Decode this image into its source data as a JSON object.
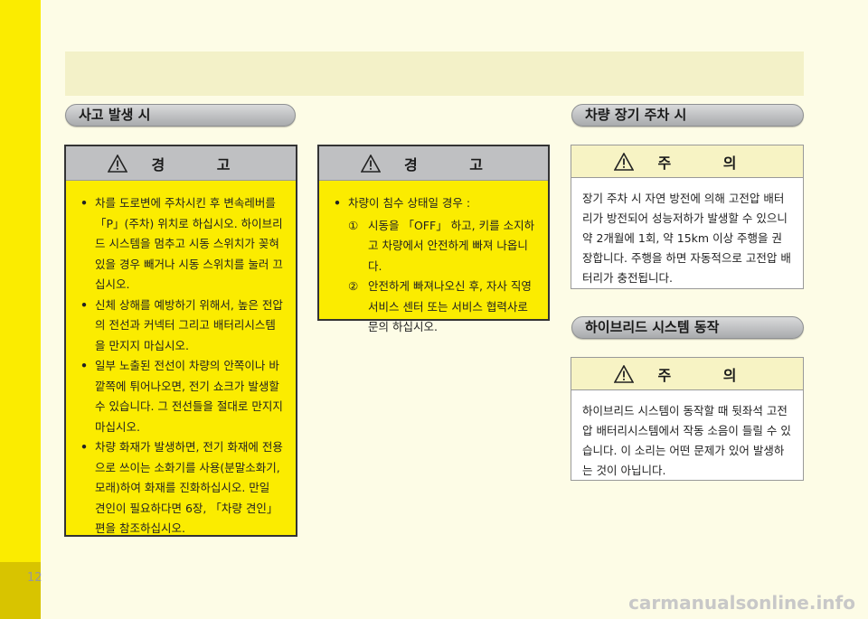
{
  "page_number": "12",
  "sections": {
    "accident": {
      "title": "사고 발생 시"
    },
    "parking": {
      "title": "차량 장기 주차 시"
    },
    "hybrid": {
      "title": "하이브리드 시스템 동작"
    }
  },
  "warning_box_1": {
    "label": "경 고",
    "items": [
      "차를 도로변에 주차시킨 후 변속레버를 「P」(주차) 위치로 하십시오. 하이브리드 시스템을 멈추고 시동 스위치가 꽂혀 있을 경우 빼거나 시동 스위치를 눌러 끄십시오.",
      "신체 상해를 예방하기 위해서, 높은 전압의 전선과 커넥터 그리고 배터리시스템을 만지지 마십시오.",
      "일부 노출된 전선이 차량의 안쪽이나 바깥쪽에 튀어나오면, 전기 쇼크가 발생할 수 있습니다. 그 전선들을 절대로 만지지 마십시오.",
      "차량 화재가 발생하면, 전기 화재에 전용으로 쓰이는 소화기를 사용(분말소화기, 모래)하여 화재를 진화하십시오. 만일 견인이 필요하다면 6장, 「차량 견인」 편을 참조하십시오."
    ]
  },
  "warning_box_2": {
    "label": "경 고",
    "item": "차량이 침수 상태일 경우 :",
    "subs": [
      {
        "num": "①",
        "text": "시동을 「OFF」 하고, 키를 소지하고 차량에서 안전하게 빠져 나옵니다."
      },
      {
        "num": "②",
        "text": "안전하게 빠져나오신 후, 자사 직영 서비스 센터 또는 서비스 협력사로 문의 하십시오."
      }
    ]
  },
  "caution_box_1": {
    "label": "주 의",
    "text": "장기 주차 시 자연 방전에 의해 고전압 배터리가 방전되어 성능저하가 발생할 수 있으니 약 2개월에 1회, 약 15km 이상 주행을 권장합니다. 주행을 하면 자동적으로 고전압 배터리가 충전됩니다."
  },
  "caution_box_2": {
    "label": "주 의",
    "text": "하이브리드 시스템이 동작할 때 뒷좌석 고전압 배터리시스템에서 작동 소음이 들릴 수 있습니다. 이 소리는 어떤 문제가 있어 발생하는 것이 아닙니다."
  },
  "watermark": "carmanualsonline.info"
}
